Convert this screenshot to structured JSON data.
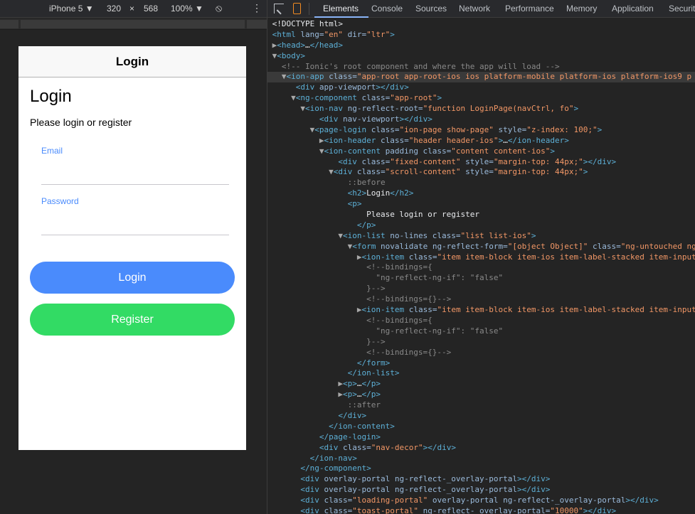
{
  "device_toolbar": {
    "device": "iPhone 5",
    "width": "320",
    "times": "×",
    "height": "568",
    "zoom": "100%"
  },
  "phone": {
    "header_title": "Login",
    "heading": "Login",
    "subtitle": "Please login or register",
    "email_label": "Email",
    "password_label": "Password",
    "login_button": "Login",
    "register_button": "Register",
    "colors": {
      "primary": "#4a8bfc",
      "secondary": "#32db64"
    }
  },
  "devtools": {
    "tabs": [
      "Elements",
      "Console",
      "Sources",
      "Network",
      "Performance",
      "Memory",
      "Application",
      "Securit"
    ],
    "active_tab": "Elements",
    "dom_lines": [
      [
        [
          "t",
          "<!DOCTYPE html>"
        ]
      ],
      [
        [
          "g",
          "<html "
        ],
        [
          "a",
          "lang="
        ],
        [
          "v",
          "\"en\""
        ],
        [
          "a",
          " dir="
        ],
        [
          "v",
          "\"ltr\""
        ],
        [
          "g",
          ">"
        ]
      ],
      [
        [
          "r",
          "▶"
        ],
        [
          "g",
          "<head>"
        ],
        [
          "t",
          "…"
        ],
        [
          "g",
          "</head>"
        ]
      ],
      [
        [
          "r",
          "▼"
        ],
        [
          "g",
          "<body>"
        ]
      ],
      [
        [
          "c",
          "  <!-- Ionic's root component and where the app will load -->"
        ]
      ],
      [
        [
          "r",
          "  ▼"
        ],
        [
          "g",
          "<ion-app "
        ],
        [
          "a",
          "class="
        ],
        [
          "v",
          "\"app-root app-root-ios ios platform-mobile platform-ios platform-ios9 p"
        ]
      ],
      [
        [
          "t",
          "     "
        ],
        [
          "g",
          "<div "
        ],
        [
          "a",
          "app-viewport"
        ],
        [
          "g",
          "></div>"
        ]
      ],
      [
        [
          "r",
          "    ▼"
        ],
        [
          "g",
          "<ng-component "
        ],
        [
          "a",
          "class="
        ],
        [
          "v",
          "\"app-root\""
        ],
        [
          "g",
          ">"
        ]
      ],
      [
        [
          "r",
          "      ▼"
        ],
        [
          "g",
          "<ion-nav "
        ],
        [
          "a",
          "ng-reflect-root="
        ],
        [
          "v",
          "\"function LoginPage(navCtrl, fo\""
        ],
        [
          "g",
          ">"
        ]
      ],
      [
        [
          "t",
          "          "
        ],
        [
          "g",
          "<div "
        ],
        [
          "a",
          "nav-viewport"
        ],
        [
          "g",
          "></div>"
        ]
      ],
      [
        [
          "r",
          "        ▼"
        ],
        [
          "g",
          "<page-login "
        ],
        [
          "a",
          "class="
        ],
        [
          "v",
          "\"ion-page show-page\""
        ],
        [
          "a",
          " style="
        ],
        [
          "v",
          "\"z-index: 100;\""
        ],
        [
          "g",
          ">"
        ]
      ],
      [
        [
          "r",
          "          ▶"
        ],
        [
          "g",
          "<ion-header "
        ],
        [
          "a",
          "class="
        ],
        [
          "v",
          "\"header header-ios\""
        ],
        [
          "g",
          ">"
        ],
        [
          "t",
          "…"
        ],
        [
          "g",
          "</ion-header>"
        ]
      ],
      [
        [
          "r",
          "          ▼"
        ],
        [
          "g",
          "<ion-content "
        ],
        [
          "a",
          "padding class="
        ],
        [
          "v",
          "\"content content-ios\""
        ],
        [
          "g",
          ">"
        ]
      ],
      [
        [
          "t",
          "              "
        ],
        [
          "g",
          "<div "
        ],
        [
          "a",
          "class="
        ],
        [
          "v",
          "\"fixed-content\""
        ],
        [
          "a",
          " style="
        ],
        [
          "v",
          "\"margin-top: 44px;\""
        ],
        [
          "g",
          "></div>"
        ]
      ],
      [
        [
          "r",
          "            ▼"
        ],
        [
          "g",
          "<div "
        ],
        [
          "a",
          "class="
        ],
        [
          "v",
          "\"scroll-content\""
        ],
        [
          "a",
          " style="
        ],
        [
          "v",
          "\"margin-top: 44px;\""
        ],
        [
          "g",
          ">"
        ]
      ],
      [
        [
          "t",
          "                "
        ],
        [
          "c",
          "::before"
        ]
      ],
      [
        [
          "t",
          "                "
        ],
        [
          "g",
          "<h2>"
        ],
        [
          "t",
          "Login"
        ],
        [
          "g",
          "</h2>"
        ]
      ],
      [
        [
          "t",
          "                "
        ],
        [
          "g",
          "<p>"
        ]
      ],
      [
        [
          "t",
          "                    Please login or register"
        ]
      ],
      [
        [
          "t",
          "                  "
        ],
        [
          "g",
          "</p>"
        ]
      ],
      [
        [
          "r",
          "              ▼"
        ],
        [
          "g",
          "<ion-list "
        ],
        [
          "a",
          "no-lines class="
        ],
        [
          "v",
          "\"list list-ios\""
        ],
        [
          "g",
          ">"
        ]
      ],
      [
        [
          "r",
          "                ▼"
        ],
        [
          "g",
          "<form "
        ],
        [
          "a",
          "novalidate ng-reflect-form="
        ],
        [
          "v",
          "\"[object Object]\""
        ],
        [
          "a",
          " class="
        ],
        [
          "v",
          "\"ng-untouched ng"
        ]
      ],
      [
        [
          "r",
          "                  ▶"
        ],
        [
          "g",
          "<ion-item "
        ],
        [
          "a",
          "class="
        ],
        [
          "v",
          "\"item item-block item-ios item-label-stacked item-input"
        ]
      ],
      [
        [
          "t",
          "                    "
        ],
        [
          "c",
          "<!--bindings={"
        ]
      ],
      [
        [
          "t",
          "                      "
        ],
        [
          "c",
          "\"ng-reflect-ng-if\": \"false\""
        ]
      ],
      [
        [
          "t",
          "                    "
        ],
        [
          "c",
          "}-->"
        ]
      ],
      [
        [
          "t",
          "                    "
        ],
        [
          "c",
          "<!--bindings={}-->"
        ]
      ],
      [
        [
          "r",
          "                  ▶"
        ],
        [
          "g",
          "<ion-item "
        ],
        [
          "a",
          "class="
        ],
        [
          "v",
          "\"item item-block item-ios item-label-stacked item-input"
        ]
      ],
      [
        [
          "t",
          "                    "
        ],
        [
          "c",
          "<!--bindings={"
        ]
      ],
      [
        [
          "t",
          "                      "
        ],
        [
          "c",
          "\"ng-reflect-ng-if\": \"false\""
        ]
      ],
      [
        [
          "t",
          "                    "
        ],
        [
          "c",
          "}-->"
        ]
      ],
      [
        [
          "t",
          "                    "
        ],
        [
          "c",
          "<!--bindings={}-->"
        ]
      ],
      [
        [
          "t",
          "                  "
        ],
        [
          "g",
          "</form>"
        ]
      ],
      [
        [
          "t",
          "                "
        ],
        [
          "g",
          "</ion-list>"
        ]
      ],
      [
        [
          "r",
          "              ▶"
        ],
        [
          "g",
          "<p>"
        ],
        [
          "t",
          "…"
        ],
        [
          "g",
          "</p>"
        ]
      ],
      [
        [
          "r",
          "              ▶"
        ],
        [
          "g",
          "<p>"
        ],
        [
          "t",
          "…"
        ],
        [
          "g",
          "</p>"
        ]
      ],
      [
        [
          "t",
          "                "
        ],
        [
          "c",
          "::after"
        ]
      ],
      [
        [
          "t",
          "              "
        ],
        [
          "g",
          "</div>"
        ]
      ],
      [
        [
          "t",
          "            "
        ],
        [
          "g",
          "</ion-content>"
        ]
      ],
      [
        [
          "t",
          "          "
        ],
        [
          "g",
          "</page-login>"
        ]
      ],
      [
        [
          "t",
          "          "
        ],
        [
          "g",
          "<div "
        ],
        [
          "a",
          "class="
        ],
        [
          "v",
          "\"nav-decor\""
        ],
        [
          "g",
          "></div>"
        ]
      ],
      [
        [
          "t",
          "        "
        ],
        [
          "g",
          "</ion-nav>"
        ]
      ],
      [
        [
          "t",
          "      "
        ],
        [
          "g",
          "</ng-component>"
        ]
      ],
      [
        [
          "t",
          "      "
        ],
        [
          "g",
          "<div "
        ],
        [
          "a",
          "overlay-portal ng-reflect-_overlay-portal"
        ],
        [
          "g",
          "></div>"
        ]
      ],
      [
        [
          "t",
          "      "
        ],
        [
          "g",
          "<div "
        ],
        [
          "a",
          "overlay-portal ng-reflect-_overlay-portal"
        ],
        [
          "g",
          "></div>"
        ]
      ],
      [
        [
          "t",
          "      "
        ],
        [
          "g",
          "<div "
        ],
        [
          "a",
          "class="
        ],
        [
          "v",
          "\"loading-portal\""
        ],
        [
          "a",
          " overlay-portal ng-reflect-_overlay-portal"
        ],
        [
          "g",
          "></div>"
        ]
      ],
      [
        [
          "t",
          "      "
        ],
        [
          "g",
          "<div "
        ],
        [
          "a",
          "class="
        ],
        [
          "v",
          "\"toast-portal\""
        ],
        [
          "a",
          " ng-reflect-_overlay-portal="
        ],
        [
          "v",
          "\"10000\""
        ],
        [
          "g",
          "></div>"
        ]
      ]
    ],
    "selected_line": 5
  }
}
